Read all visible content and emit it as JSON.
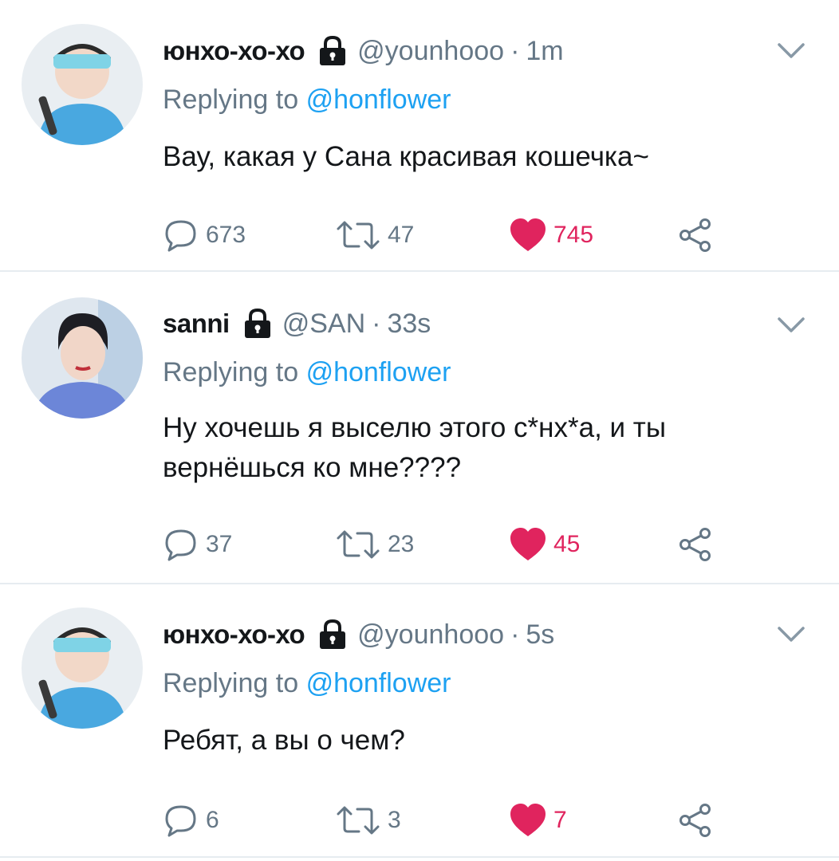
{
  "tweets": [
    {
      "display_name": "юнхо-хо-хо",
      "handle": "@younhooo",
      "separator": "·",
      "time": "1m",
      "replying_prefix": "Replying to",
      "replying_to": "@honflower",
      "text": "Вау, какая у Сана красивая кошечка~",
      "replies": "673",
      "retweets": "47",
      "likes": "745",
      "liked": true,
      "protected": true
    },
    {
      "display_name": "sanni",
      "handle": "@SAN",
      "separator": "·",
      "time": "33s",
      "replying_prefix": "Replying to",
      "replying_to": "@honflower",
      "text": "Ну хочешь я выселю этого с*нх*а, и ты вернёшься ко мне????",
      "replies": "37",
      "retweets": "23",
      "likes": "45",
      "liked": true,
      "protected": true
    },
    {
      "display_name": "юнхо-хо-хо",
      "handle": "@younhooo",
      "separator": "·",
      "time": "5s",
      "replying_prefix": "Replying to",
      "replying_to": "@honflower",
      "text": "Ребят, а вы о чем?",
      "replies": "6",
      "retweets": "3",
      "likes": "7",
      "liked": true,
      "protected": true
    }
  ],
  "colors": {
    "text": "#14171a",
    "secondary": "#657786",
    "link": "#1da1f2",
    "like": "#e0245e",
    "divider": "#e6ecf0"
  },
  "icons": {
    "reply": "reply-icon",
    "retweet": "retweet-icon",
    "like": "heart-icon",
    "share": "share-icon",
    "lock": "lock-icon",
    "more": "chevron-down-icon"
  }
}
